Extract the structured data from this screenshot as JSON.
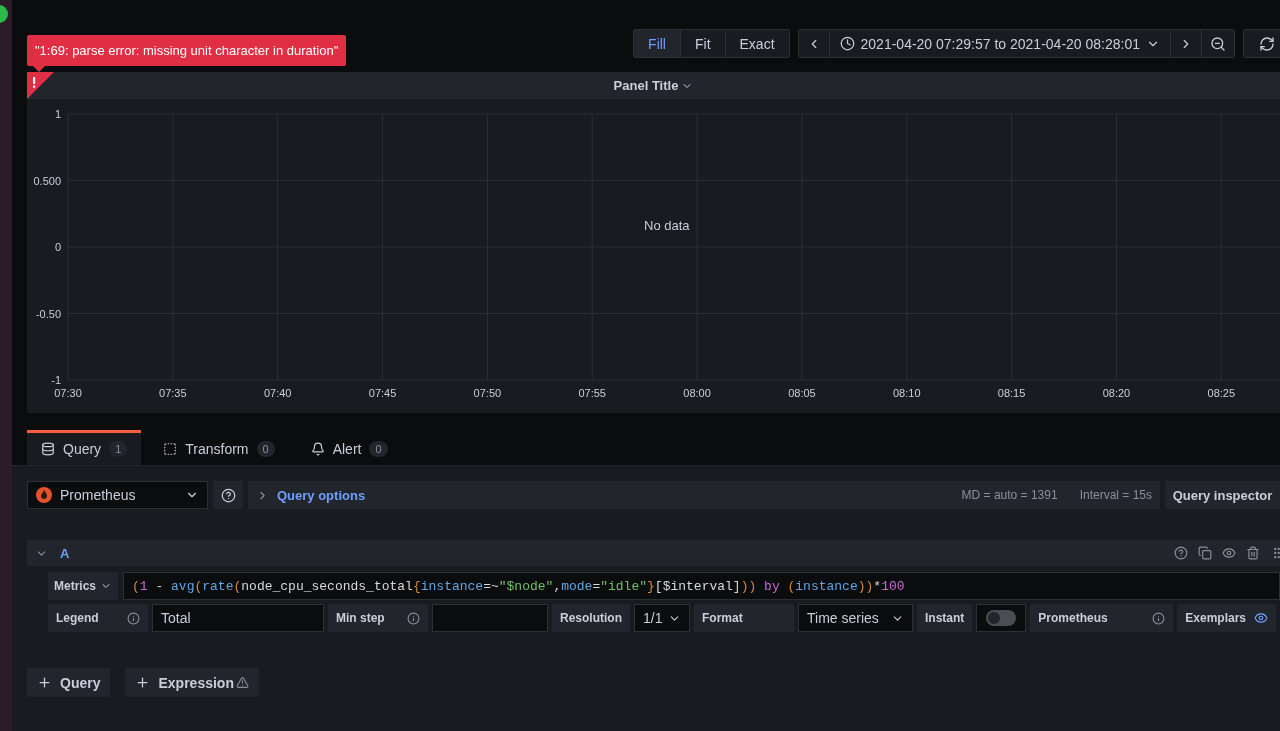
{
  "error_tooltip": "\"1:69: parse error: missing unit character in duration\"",
  "display_modes": [
    {
      "label": "Fill",
      "selected": true
    },
    {
      "label": "Fit",
      "selected": false
    },
    {
      "label": "Exact",
      "selected": false
    }
  ],
  "time_range": "2021-04-20 07:29:57 to 2021-04-20 08:28:01",
  "panel": {
    "title": "Panel Title",
    "error": true,
    "message": "No data",
    "chart_data": {
      "type": "line",
      "grid": true,
      "ylim": [
        -1,
        1
      ],
      "categories": [
        "07:30",
        "07:35",
        "07:40",
        "07:45",
        "07:50",
        "07:55",
        "08:00",
        "08:05",
        "08:10",
        "08:15",
        "08:20",
        "08:25"
      ],
      "yticks": [
        {
          "value": 1,
          "label": "1"
        },
        {
          "value": 0.5,
          "label": "0.500"
        },
        {
          "value": 0,
          "label": "0"
        },
        {
          "value": -0.5,
          "label": "-0.50"
        },
        {
          "value": -1,
          "label": "-1"
        }
      ]
    }
  },
  "tabs": [
    {
      "kind": "query",
      "label": "Query",
      "count": "1",
      "selected": true
    },
    {
      "kind": "transform",
      "label": "Transform",
      "count": "0",
      "selected": false
    },
    {
      "kind": "alert",
      "label": "Alert",
      "count": "0",
      "selected": false
    }
  ],
  "datasource": "Prometheus",
  "query_options": {
    "label": "Query options",
    "max_data_points": "MD = auto = 1391",
    "interval": "Interval = 15s"
  },
  "query_inspector": "Query inspector",
  "query": {
    "ref": "A",
    "expanded": true,
    "metrics_label": "Metrics",
    "tokens": [
      {
        "kind": "paren",
        "text": "("
      },
      {
        "kind": "number",
        "text": "1"
      },
      {
        "kind": "plain",
        "text": " - "
      },
      {
        "kind": "func",
        "text": "avg"
      },
      {
        "kind": "paren",
        "text": "("
      },
      {
        "kind": "func",
        "text": "rate"
      },
      {
        "kind": "paren",
        "text": "("
      },
      {
        "kind": "plain",
        "text": "node_cpu_seconds_total"
      },
      {
        "kind": "paren",
        "text": "{"
      },
      {
        "kind": "label",
        "text": "instance"
      },
      {
        "kind": "plain",
        "text": "=~"
      },
      {
        "kind": "string",
        "text": "\"$node\""
      },
      {
        "kind": "plain",
        "text": ","
      },
      {
        "kind": "label",
        "text": "mode"
      },
      {
        "kind": "plain",
        "text": "="
      },
      {
        "kind": "string",
        "text": "\"idle\""
      },
      {
        "kind": "paren",
        "text": "}"
      },
      {
        "kind": "plain",
        "text": "[$interval]"
      },
      {
        "kind": "paren",
        "text": "))"
      },
      {
        "kind": "keyword",
        "text": " by "
      },
      {
        "kind": "paren",
        "text": "("
      },
      {
        "kind": "label",
        "text": "instance"
      },
      {
        "kind": "paren",
        "text": "))"
      },
      {
        "kind": "plain",
        "text": "*"
      },
      {
        "kind": "number",
        "text": "100"
      }
    ],
    "options": [
      {
        "kind": "label",
        "text": "Legend",
        "info": true
      },
      {
        "kind": "input",
        "value": "Total"
      },
      {
        "kind": "label",
        "text": "Min step",
        "info": true
      },
      {
        "kind": "input"
      },
      {
        "kind": "label",
        "text": "Resolution",
        "info": false
      },
      {
        "kind": "select",
        "value": "1/1"
      },
      {
        "kind": "label",
        "text": "Format",
        "info": false
      },
      {
        "kind": "select",
        "value": "Time series"
      },
      {
        "kind": "label",
        "text": "Instant",
        "info": false
      },
      {
        "kind": "switch",
        "on": false
      },
      {
        "kind": "label",
        "text": "Prometheus",
        "info": true
      },
      {
        "kind": "toggle-label",
        "text": "Exemplars",
        "on": true
      }
    ]
  },
  "add_buttons": [
    {
      "label": "Query",
      "warning": false
    },
    {
      "label": "Expression",
      "warning": true
    }
  ]
}
